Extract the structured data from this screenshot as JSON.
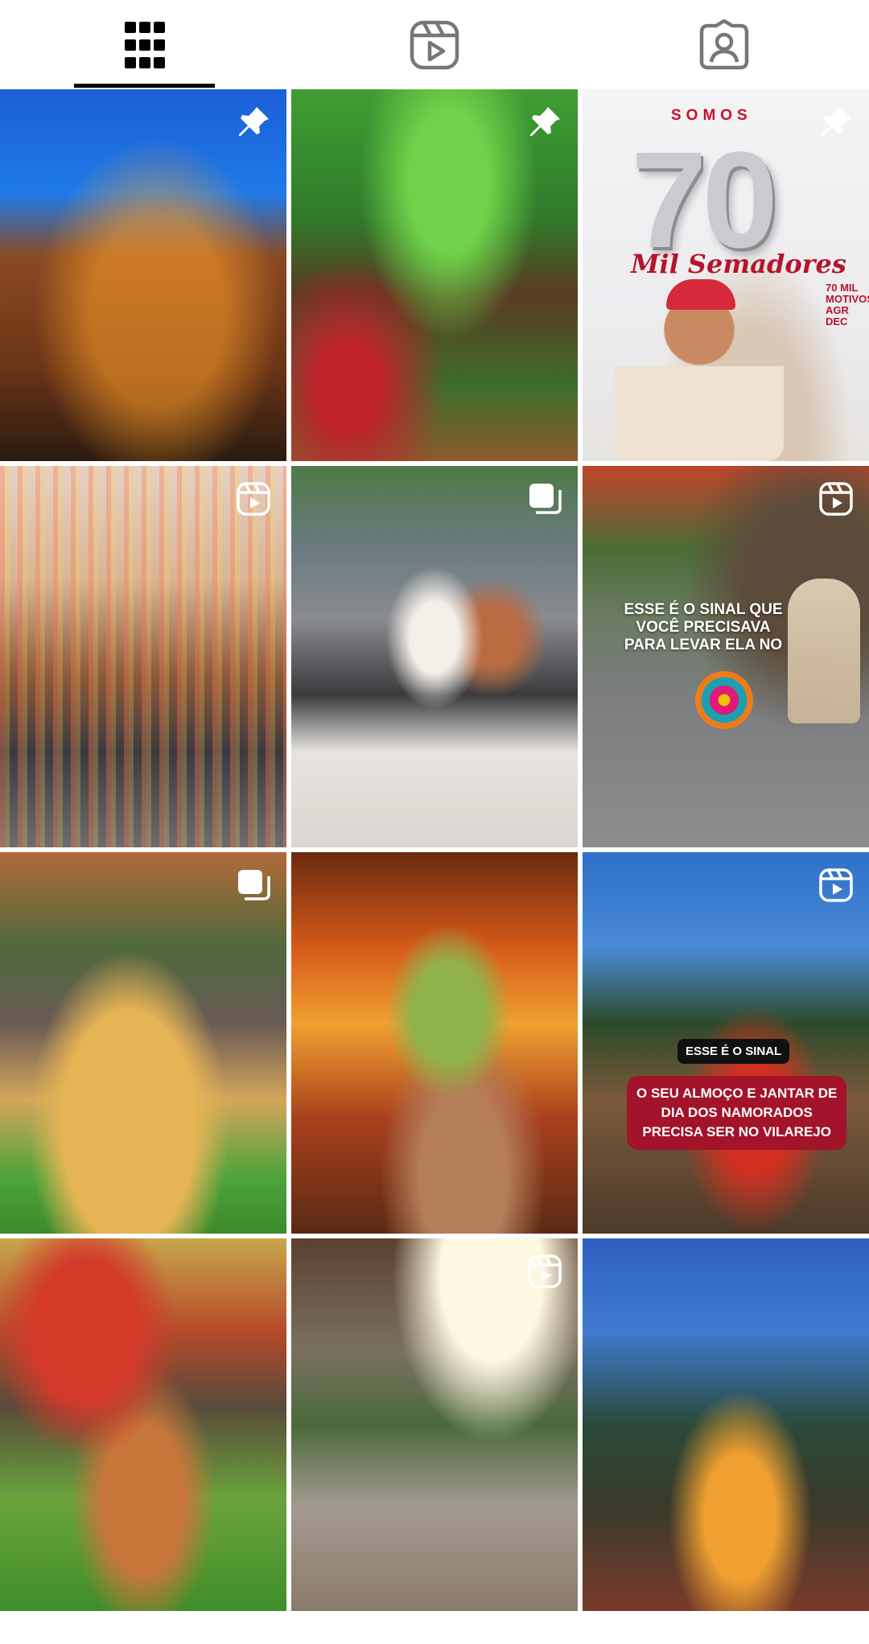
{
  "tabs": [
    {
      "name": "grid-icon",
      "selected": true
    },
    {
      "name": "reels-icon",
      "selected": false
    },
    {
      "name": "tagged-icon",
      "selected": false
    }
  ],
  "posts": [
    {
      "id": 1,
      "badge": "pin-icon"
    },
    {
      "id": 2,
      "badge": "pin-icon"
    },
    {
      "id": 3,
      "badge": "pin-icon",
      "promo": {
        "somos": "SOMOS",
        "number": "70",
        "tagline": "Mil Semadores",
        "side_lines": [
          "70 MIL",
          "MOTIVOS",
          "AGR",
          "DEC"
        ]
      }
    },
    {
      "id": 4,
      "badge": "reel-icon"
    },
    {
      "id": 5,
      "badge": "carousel-icon"
    },
    {
      "id": 6,
      "badge": "reel-icon",
      "overlay": {
        "line1": "ESSE É O SINAL QUE",
        "line2": "VOCÊ PRECISAVA",
        "line3": "PARA LEVAR ELA NO"
      }
    },
    {
      "id": 7,
      "badge": "carousel-icon"
    },
    {
      "id": 8,
      "badge": ""
    },
    {
      "id": 9,
      "badge": "reel-icon",
      "sign_label": "ESSE É O SINAL",
      "message": {
        "line1": "O SEU ALMOÇO E JANTAR DE",
        "line2": "DIA DOS NAMORADOS",
        "line3": "PRECISA SER NO VILAREJO"
      }
    },
    {
      "id": 10,
      "badge": ""
    },
    {
      "id": 11,
      "badge": "reel-icon"
    },
    {
      "id": 12,
      "badge": ""
    }
  ],
  "colors": {
    "accent_red": "#a3132a",
    "tab_selected": "#000000",
    "tab_unselected": "#777777"
  }
}
